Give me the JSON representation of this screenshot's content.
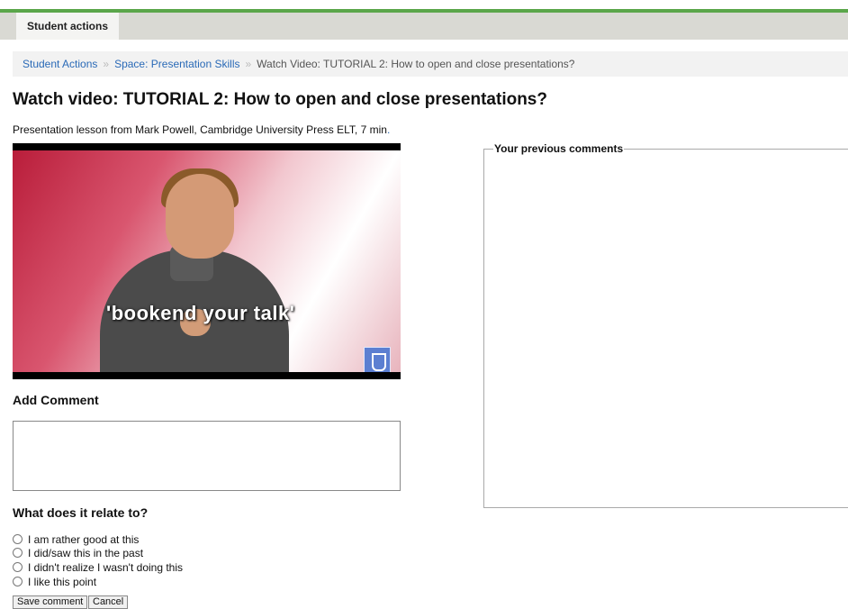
{
  "tabs": [
    {
      "label": "Student actions"
    }
  ],
  "breadcrumb": {
    "items": [
      "Student Actions",
      "Space: Presentation Skills"
    ],
    "current": "Watch Video: TUTORIAL 2: How to open and close presentations?",
    "separator": "»"
  },
  "page_title": "Watch video: TUTORIAL 2: How to open and close presentations?",
  "lesson_info": "Presentation lesson from Mark Powell, Cambridge University Press ELT, 7 min",
  "lesson_info_end": ".",
  "video": {
    "caption": "'bookend your talk'"
  },
  "add_comment": {
    "heading": "Add Comment",
    "value": ""
  },
  "relate": {
    "heading": "What does it relate to?",
    "options": [
      "I am rather good at this",
      "I did/saw this in the past",
      "I didn't realize I wasn't doing this",
      "I like this point"
    ]
  },
  "buttons": {
    "save": "Save comment",
    "cancel": "Cancel"
  },
  "previous_comments": {
    "legend": "Your previous comments"
  },
  "colors": {
    "accent_green": "#5aa64a",
    "link_blue": "#2a6ab7"
  }
}
